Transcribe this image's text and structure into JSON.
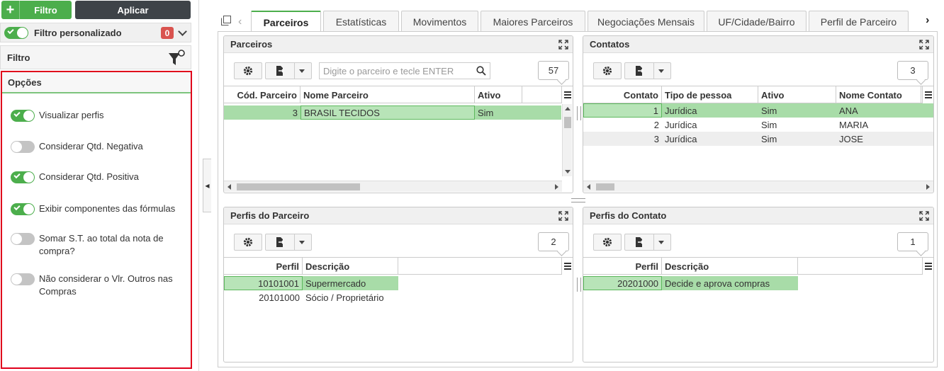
{
  "filter_panel": {
    "add_filter_label": "Filtro",
    "apply_label": "Aplicar",
    "custom_filter_label": "Filtro personalizado",
    "custom_filter_count": "0",
    "filter_title": "Filtro",
    "options_title": "Opções",
    "options": [
      {
        "label": "Visualizar perfis",
        "enabled": true
      },
      {
        "label": "Considerar Qtd. Negativa",
        "enabled": false
      },
      {
        "label": "Considerar Qtd. Positiva",
        "enabled": true
      },
      {
        "label": "Exibir componentes das fórmulas",
        "enabled": true
      },
      {
        "label": "Somar S.T. ao total da nota de compra?",
        "enabled": false
      },
      {
        "label": "Não considerar o Vlr. Outros nas Compras",
        "enabled": false
      }
    ]
  },
  "tabs": [
    {
      "label": "Parceiros",
      "active": true
    },
    {
      "label": "Estatísticas"
    },
    {
      "label": "Movimentos"
    },
    {
      "label": "Maiores Parceiros"
    },
    {
      "label": "Negociações Mensais"
    },
    {
      "label": "UF/Cidade/Bairro"
    },
    {
      "label": "Perfil de Parceiro"
    }
  ],
  "parceiros": {
    "title": "Parceiros",
    "search_placeholder": "Digite o parceiro e tecle ENTER",
    "count": "57",
    "columns": [
      "Cód. Parceiro",
      "Nome Parceiro",
      "Ativo"
    ],
    "rows": [
      [
        "3",
        "BRASIL TECIDOS",
        "Sim"
      ]
    ]
  },
  "contatos": {
    "title": "Contatos",
    "count": "3",
    "columns": [
      "Contato",
      "Tipo de pessoa",
      "Ativo",
      "Nome Contato"
    ],
    "rows": [
      [
        "1",
        "Jurídica",
        "Sim",
        "ANA"
      ],
      [
        "2",
        "Jurídica",
        "Sim",
        "MARIA"
      ],
      [
        "3",
        "Jurídica",
        "Sim",
        "JOSE"
      ]
    ]
  },
  "perfis_parceiro": {
    "title": "Perfis do Parceiro",
    "count": "2",
    "columns": [
      "Perfil",
      "Descrição"
    ],
    "rows": [
      [
        "10101001",
        "Supermercado"
      ],
      [
        "20101000",
        "Sócio / Proprietário"
      ]
    ]
  },
  "perfis_contato": {
    "title": "Perfis do Contato",
    "count": "1",
    "columns": [
      "Perfil",
      "Descrição"
    ],
    "rows": [
      [
        "20201000",
        "Decide e aprova compras"
      ]
    ]
  },
  "colors": {
    "accent": "#4cae4c",
    "selected_row": "#a8dca8",
    "highlight_border": "#e0001b",
    "badge": "#d9534f"
  },
  "icons": [
    "plus-icon",
    "funnel-icon",
    "chevron-down-icon",
    "window-icon",
    "gear-icon",
    "export-icon",
    "search-icon",
    "expand-icon",
    "menu-icon"
  ]
}
